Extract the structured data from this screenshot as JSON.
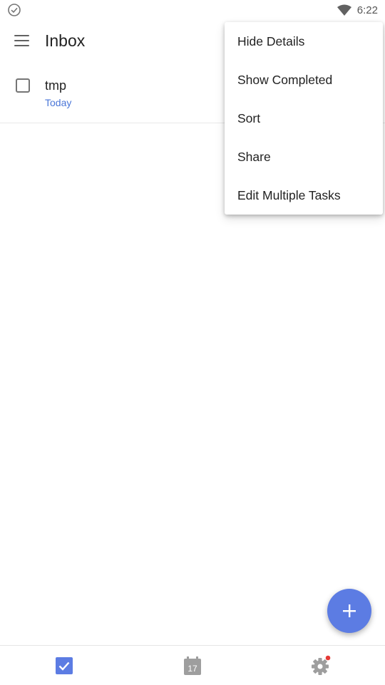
{
  "status_bar": {
    "time": "6:22",
    "left_icon": "check-circle-icon",
    "right_icons": [
      "wifi-icon"
    ]
  },
  "app_bar": {
    "title": "Inbox",
    "menu_icon": "hamburger-menu-icon"
  },
  "tasks": [
    {
      "title": "tmp",
      "due": "Today",
      "completed": false
    }
  ],
  "overflow_menu": {
    "items": [
      "Hide Details",
      "Show Completed",
      "Sort",
      "Share",
      "Edit Multiple Tasks"
    ]
  },
  "fab": {
    "icon": "plus-icon"
  },
  "bottom_nav": {
    "items": [
      {
        "icon": "checkbox-icon",
        "active": true
      },
      {
        "icon": "calendar-icon",
        "day": "17",
        "active": false
      },
      {
        "icon": "gear-icon",
        "badge": true,
        "active": false
      }
    ]
  },
  "colors": {
    "accent": "#5c7ce3",
    "due_text": "#4a76d8",
    "badge": "#e53935"
  }
}
